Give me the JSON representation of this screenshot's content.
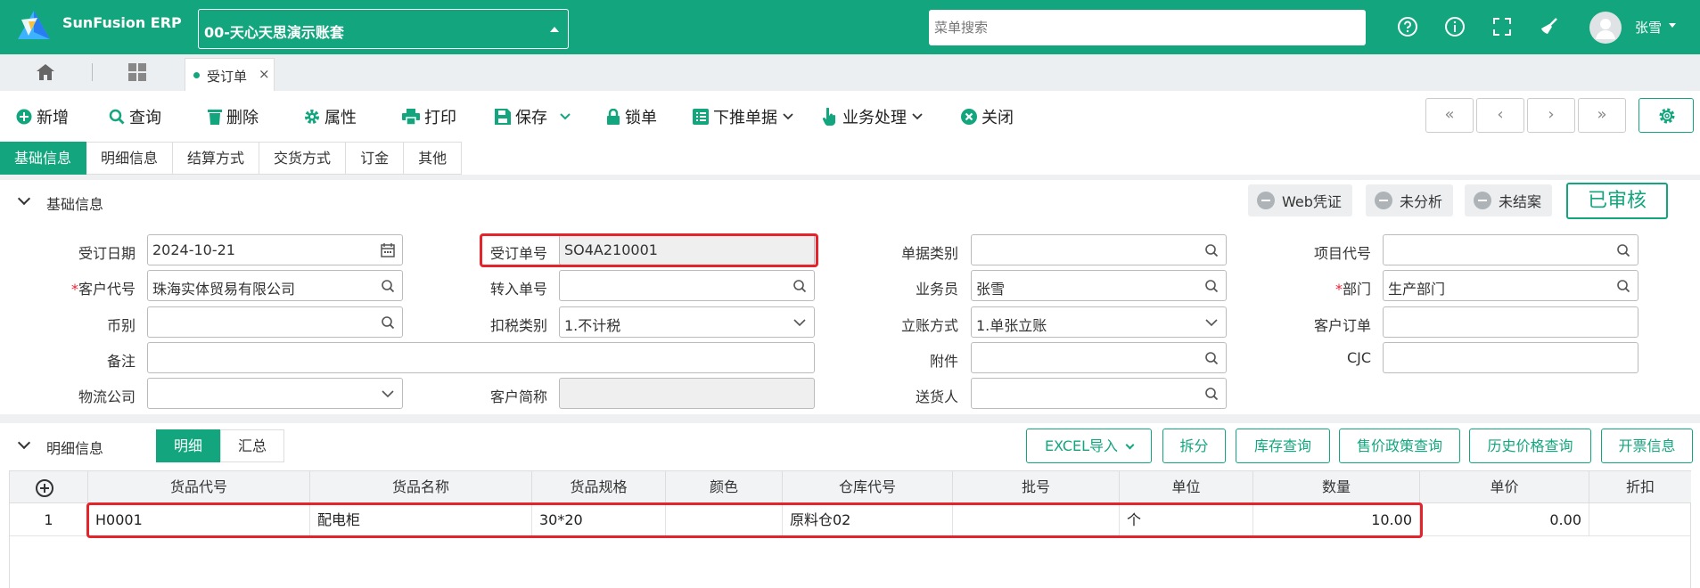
{
  "app": {
    "brand": "SunFusion ERP",
    "account": "00-天心天思演示账套",
    "search_placeholder": "菜单搜索",
    "user": "张雪"
  },
  "colors": {
    "primary": "#13a67e",
    "highlight": "#e5232a"
  },
  "tabs": {
    "doc": "受订单",
    "doc_close": "×"
  },
  "toolbar": {
    "add": "新增",
    "query": "查询",
    "delete": "删除",
    "props": "属性",
    "print": "打印",
    "save": "保存",
    "lock": "锁单",
    "push": "下推单据",
    "biz": "业务处理",
    "close": "关闭"
  },
  "nav": {
    "first": "«",
    "prev": "‹",
    "next": "›",
    "last": "»"
  },
  "subtabs": [
    "基础信息",
    "明细信息",
    "结算方式",
    "交货方式",
    "订金",
    "其他"
  ],
  "basic": {
    "title": "基础信息",
    "badges": {
      "web": "Web凭证",
      "analysis": "未分析",
      "closed": "未结案"
    },
    "status": "已审核",
    "labels": {
      "date": "受订日期",
      "order_no": "受订单号",
      "doc_type": "单据类别",
      "project": "项目代号",
      "customer_req": "*",
      "customer": "客户代号",
      "transfer": "转入单号",
      "salesman": "业务员",
      "dept_req": "*",
      "dept": "部门",
      "currency": "币别",
      "tax": "扣税类别",
      "account_way": "立账方式",
      "cust_order": "客户订单",
      "remark": "备注",
      "attach": "附件",
      "cjc": "CJC",
      "logistics": "物流公司",
      "cust_short": "客户简称",
      "deliver": "送货人"
    },
    "values": {
      "date": "2024-10-21",
      "order_no": "SO4A210001",
      "doc_type": "",
      "project": "",
      "customer": "珠海实体贸易有限公司",
      "transfer": "",
      "salesman": "张雪",
      "dept": "生产部门",
      "currency": "",
      "tax": "1.不计税",
      "account_way": "1.单张立账",
      "cust_order": "",
      "remark": "",
      "attach": "",
      "cjc": "",
      "logistics": "",
      "cust_short": "",
      "deliver": ""
    }
  },
  "detail": {
    "title": "明细信息",
    "seg": {
      "detail": "明细",
      "summary": "汇总"
    },
    "buttons": {
      "excel": "EXCEL导入",
      "split": "拆分",
      "stock": "库存查询",
      "price_policy": "售价政策查询",
      "price_history": "历史价格查询",
      "invoice": "开票信息"
    },
    "columns": [
      "货品代号",
      "货品名称",
      "货品规格",
      "颜色",
      "仓库代号",
      "批号",
      "单位",
      "数量",
      "单价",
      "折扣"
    ],
    "rows": [
      {
        "no": "1",
        "code": "H0001",
        "name": "配电柜",
        "spec": "30*20",
        "color": "",
        "warehouse": "原料仓02",
        "batch": "",
        "unit": "个",
        "qty": "10.00",
        "price": "0.00",
        "discount": ""
      }
    ]
  }
}
